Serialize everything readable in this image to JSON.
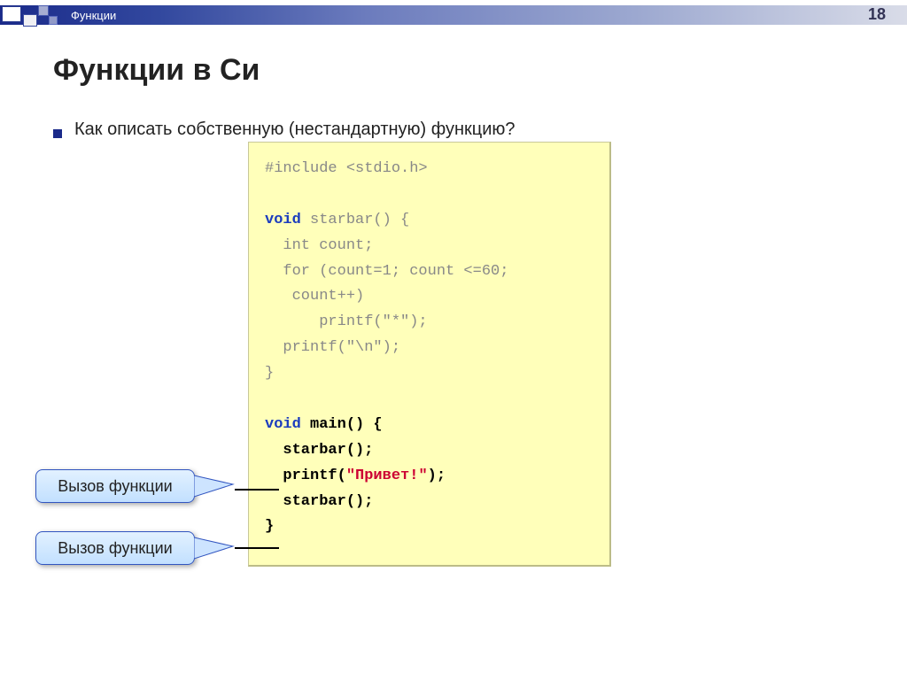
{
  "header": {
    "breadcrumb": "Функции",
    "page_number": "18"
  },
  "title": "Функции в Си",
  "bullet_text": "Как описать собственную (нестандартную) функцию?",
  "code": {
    "l1": "#include <stdio.h>",
    "l2_a": "void",
    "l2_b": " starbar() {",
    "l3": "  int count;",
    "l4": "  for (count=1; count <=60;",
    "l5": "   count++)",
    "l6": "      printf(\"*\");",
    "l7": "  printf(\"\\n\");",
    "l8": "}",
    "m1_a": "void",
    "m1_b": " main() {",
    "m2": "  starbar();",
    "m3_a": "  printf(",
    "m3_b": "\"Привет!\"",
    "m3_c": ");",
    "m4": "  starbar();",
    "m5": "}"
  },
  "callouts": {
    "c1": "Вызов функции",
    "c2": "Вызов функции"
  }
}
